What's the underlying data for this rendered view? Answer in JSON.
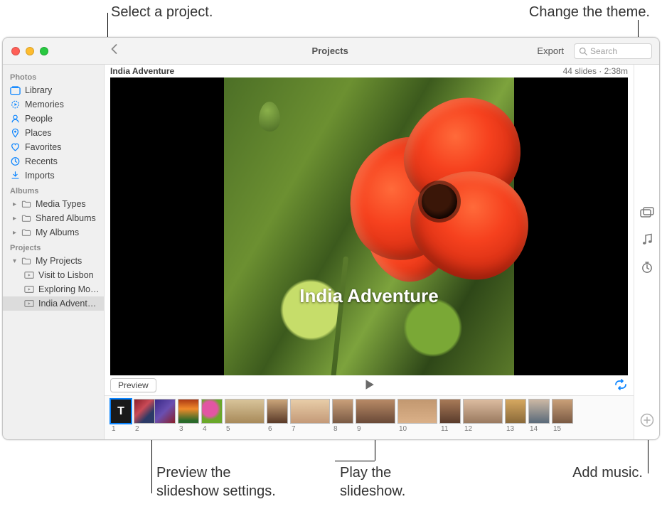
{
  "callouts": {
    "select_project": "Select a project.",
    "change_theme": "Change the theme.",
    "preview_settings": "Preview the\nslideshow settings.",
    "play_slideshow": "Play the\nslideshow.",
    "add_music": "Add music."
  },
  "titlebar": {
    "title": "Projects",
    "export": "Export",
    "search_placeholder": "Search"
  },
  "sidebar": {
    "photos_header": "Photos",
    "photos": {
      "library": "Library",
      "memories": "Memories",
      "people": "People",
      "places": "Places",
      "favorites": "Favorites",
      "recents": "Recents",
      "imports": "Imports"
    },
    "albums_header": "Albums",
    "albums": {
      "media_types": "Media Types",
      "shared": "Shared Albums",
      "my_albums": "My Albums"
    },
    "projects_header": "Projects",
    "projects": {
      "my_projects": "My Projects",
      "items": [
        {
          "label": "Visit to Lisbon"
        },
        {
          "label": "Exploring Mor…"
        },
        {
          "label": "India Adventure"
        }
      ]
    }
  },
  "project": {
    "name": "India Adventure",
    "slide_title": "India Adventure",
    "meta": "44 slides · 2:38m"
  },
  "controls": {
    "preview": "Preview"
  },
  "filmstrip": {
    "title_glyph": "T",
    "numbers": [
      "1",
      "2",
      "3",
      "4",
      "5",
      "6",
      "7",
      "8",
      "9",
      "10",
      "11",
      "12",
      "13",
      "14",
      "15"
    ]
  }
}
